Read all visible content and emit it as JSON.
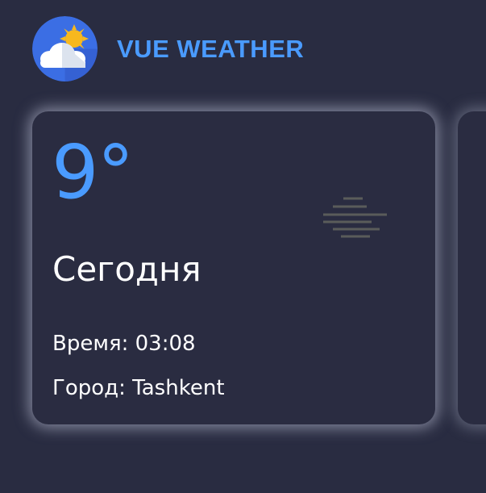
{
  "app": {
    "title": "VUE WEATHER",
    "logo_icon": "cloud-sun-icon"
  },
  "weather": {
    "temperature": "9°",
    "day": "Сегодня",
    "time_line": "Время: 03:08",
    "city_line": "Город: Tashkent",
    "condition_icon": "fog-icon"
  },
  "colors": {
    "background": "#292c41",
    "accent": "#4a9bff",
    "text": "#ffffff"
  }
}
